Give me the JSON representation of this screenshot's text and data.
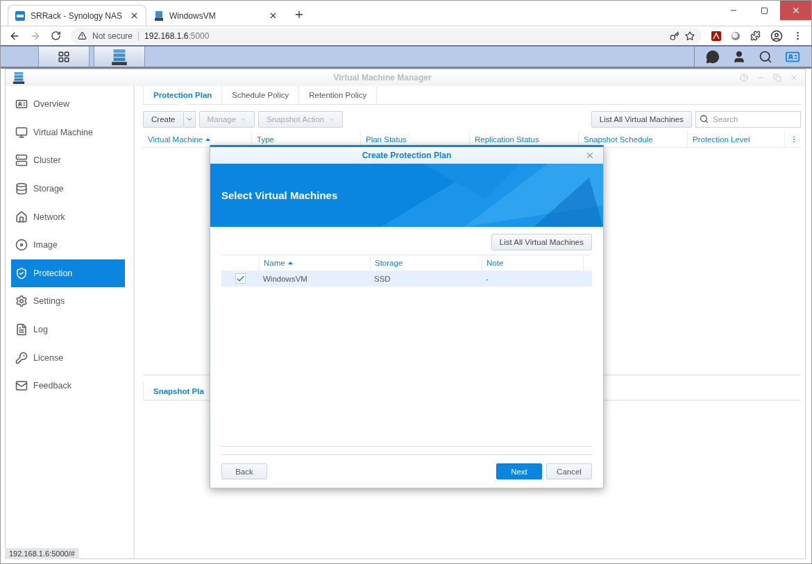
{
  "browser": {
    "tabs": [
      {
        "title": "SRRack - Synology NAS",
        "selected": true
      },
      {
        "title": "WindowsVM",
        "selected": false
      }
    ],
    "address": {
      "security": "Not secure",
      "host": "192.168.1.6",
      "port": ":5000"
    },
    "status_url": "192.168.1.6:5000/#"
  },
  "app": {
    "title": "Virtual Machine Manager",
    "sidebar": [
      {
        "label": "Overview",
        "selected": false
      },
      {
        "label": "Virtual Machine",
        "selected": false
      },
      {
        "label": "Cluster",
        "selected": false
      },
      {
        "label": "Storage",
        "selected": false
      },
      {
        "label": "Network",
        "selected": false
      },
      {
        "label": "Image",
        "selected": false
      },
      {
        "label": "Protection",
        "selected": true
      },
      {
        "label": "Settings",
        "selected": false
      },
      {
        "label": "Log",
        "selected": false
      },
      {
        "label": "License",
        "selected": false
      },
      {
        "label": "Feedback",
        "selected": false
      }
    ],
    "tabs": [
      {
        "label": "Protection Plan",
        "selected": true
      },
      {
        "label": "Schedule Policy",
        "selected": false
      },
      {
        "label": "Retention Policy",
        "selected": false
      }
    ],
    "toolbar": [
      {
        "label": "Create",
        "kind": "split",
        "disabled": false
      },
      {
        "label": "Manage",
        "kind": "dropdown",
        "disabled": true
      },
      {
        "label": "Snapshot Action",
        "kind": "dropdown",
        "disabled": true
      }
    ],
    "list_button": "List All Virtual Machines",
    "search": {
      "placeholder": "Search"
    },
    "columns": [
      {
        "label": "Virtual Machine",
        "sorted": true
      },
      {
        "label": "Type",
        "sorted": false
      },
      {
        "label": "Plan Status",
        "sorted": false
      },
      {
        "label": "Replication Status",
        "sorted": false
      },
      {
        "label": "Snapshot Schedule",
        "sorted": false
      },
      {
        "label": "Protection Level",
        "sorted": false
      }
    ],
    "bottom_tabs": [
      {
        "label": "Snapshot Pla",
        "selected": true
      }
    ]
  },
  "dialog": {
    "title": "Create Protection Plan",
    "heading": "Select Virtual Machines",
    "list_button": "List All Virtual Machines",
    "columns": [
      {
        "label": "Name",
        "sorted": true
      },
      {
        "label": "Storage",
        "sorted": false
      },
      {
        "label": "Note",
        "sorted": false
      }
    ],
    "rows": [
      {
        "checked": true,
        "selected": true,
        "cells": [
          "WindowsVM",
          "SSD",
          "-"
        ]
      }
    ],
    "buttons": [
      {
        "label": "Back",
        "kind": "secondary"
      },
      {
        "label": "Next",
        "kind": "primary"
      },
      {
        "label": "Cancel",
        "kind": "secondary"
      }
    ]
  }
}
